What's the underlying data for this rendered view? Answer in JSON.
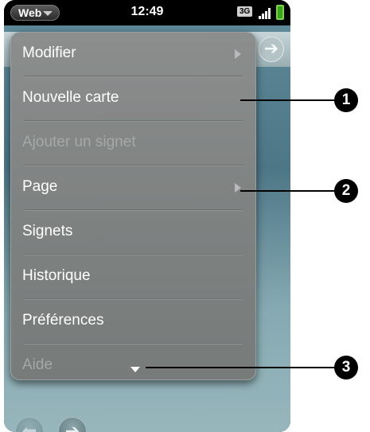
{
  "status_bar": {
    "app_menu_label": "Web",
    "time": "12:49",
    "network": "3G"
  },
  "menu": {
    "items": [
      {
        "label": "Modifier",
        "enabled": true,
        "submenu": true
      },
      {
        "label": "Nouvelle carte",
        "enabled": true,
        "submenu": false
      },
      {
        "label": "Ajouter un signet",
        "enabled": false,
        "submenu": false
      },
      {
        "label": "Page",
        "enabled": true,
        "submenu": true
      },
      {
        "label": "Signets",
        "enabled": true,
        "submenu": false
      },
      {
        "label": "Historique",
        "enabled": true,
        "submenu": false
      },
      {
        "label": "Préférences",
        "enabled": true,
        "submenu": false
      },
      {
        "label": "Aide",
        "enabled": false,
        "submenu": false
      }
    ]
  },
  "callouts": [
    "1",
    "2",
    "3"
  ],
  "colors": {
    "menu_background": "#808483",
    "battery": "#3aa51a",
    "callout": "#000000"
  }
}
